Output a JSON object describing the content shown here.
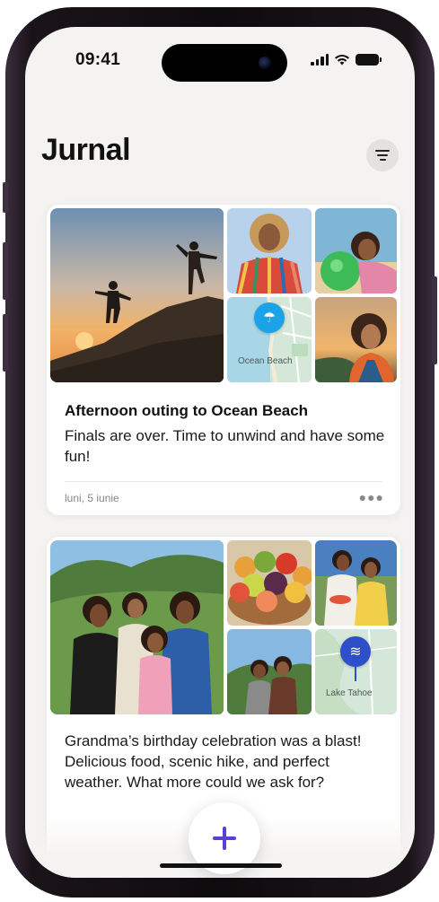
{
  "status_bar": {
    "time": "09:41"
  },
  "header": {
    "title": "Jurnal",
    "filter_icon": "filter-icon"
  },
  "entries": [
    {
      "title": "Afternoon outing to Ocean Beach",
      "body": "Finals are over. Time to unwind and have some fun!",
      "date": "luni, 5 iunie",
      "map_label": "Ocean Beach",
      "map_icon": "beach-umbrella-icon"
    },
    {
      "title": "",
      "body": "Grandma’s birthday celebration was a blast! Delicious food, scenic hike, and perfect weather. What more could we ask for?",
      "date": "",
      "map_label": "Lake Tahoe",
      "map_icon": "water-waves-icon"
    }
  ],
  "add_button": {
    "icon": "plus-icon"
  },
  "colors": {
    "accent": "#5a3fd6",
    "map_pin_beach": "#1aa3e8",
    "map_pin_lake": "#2f4fc9",
    "background": "#f5f3f1"
  }
}
